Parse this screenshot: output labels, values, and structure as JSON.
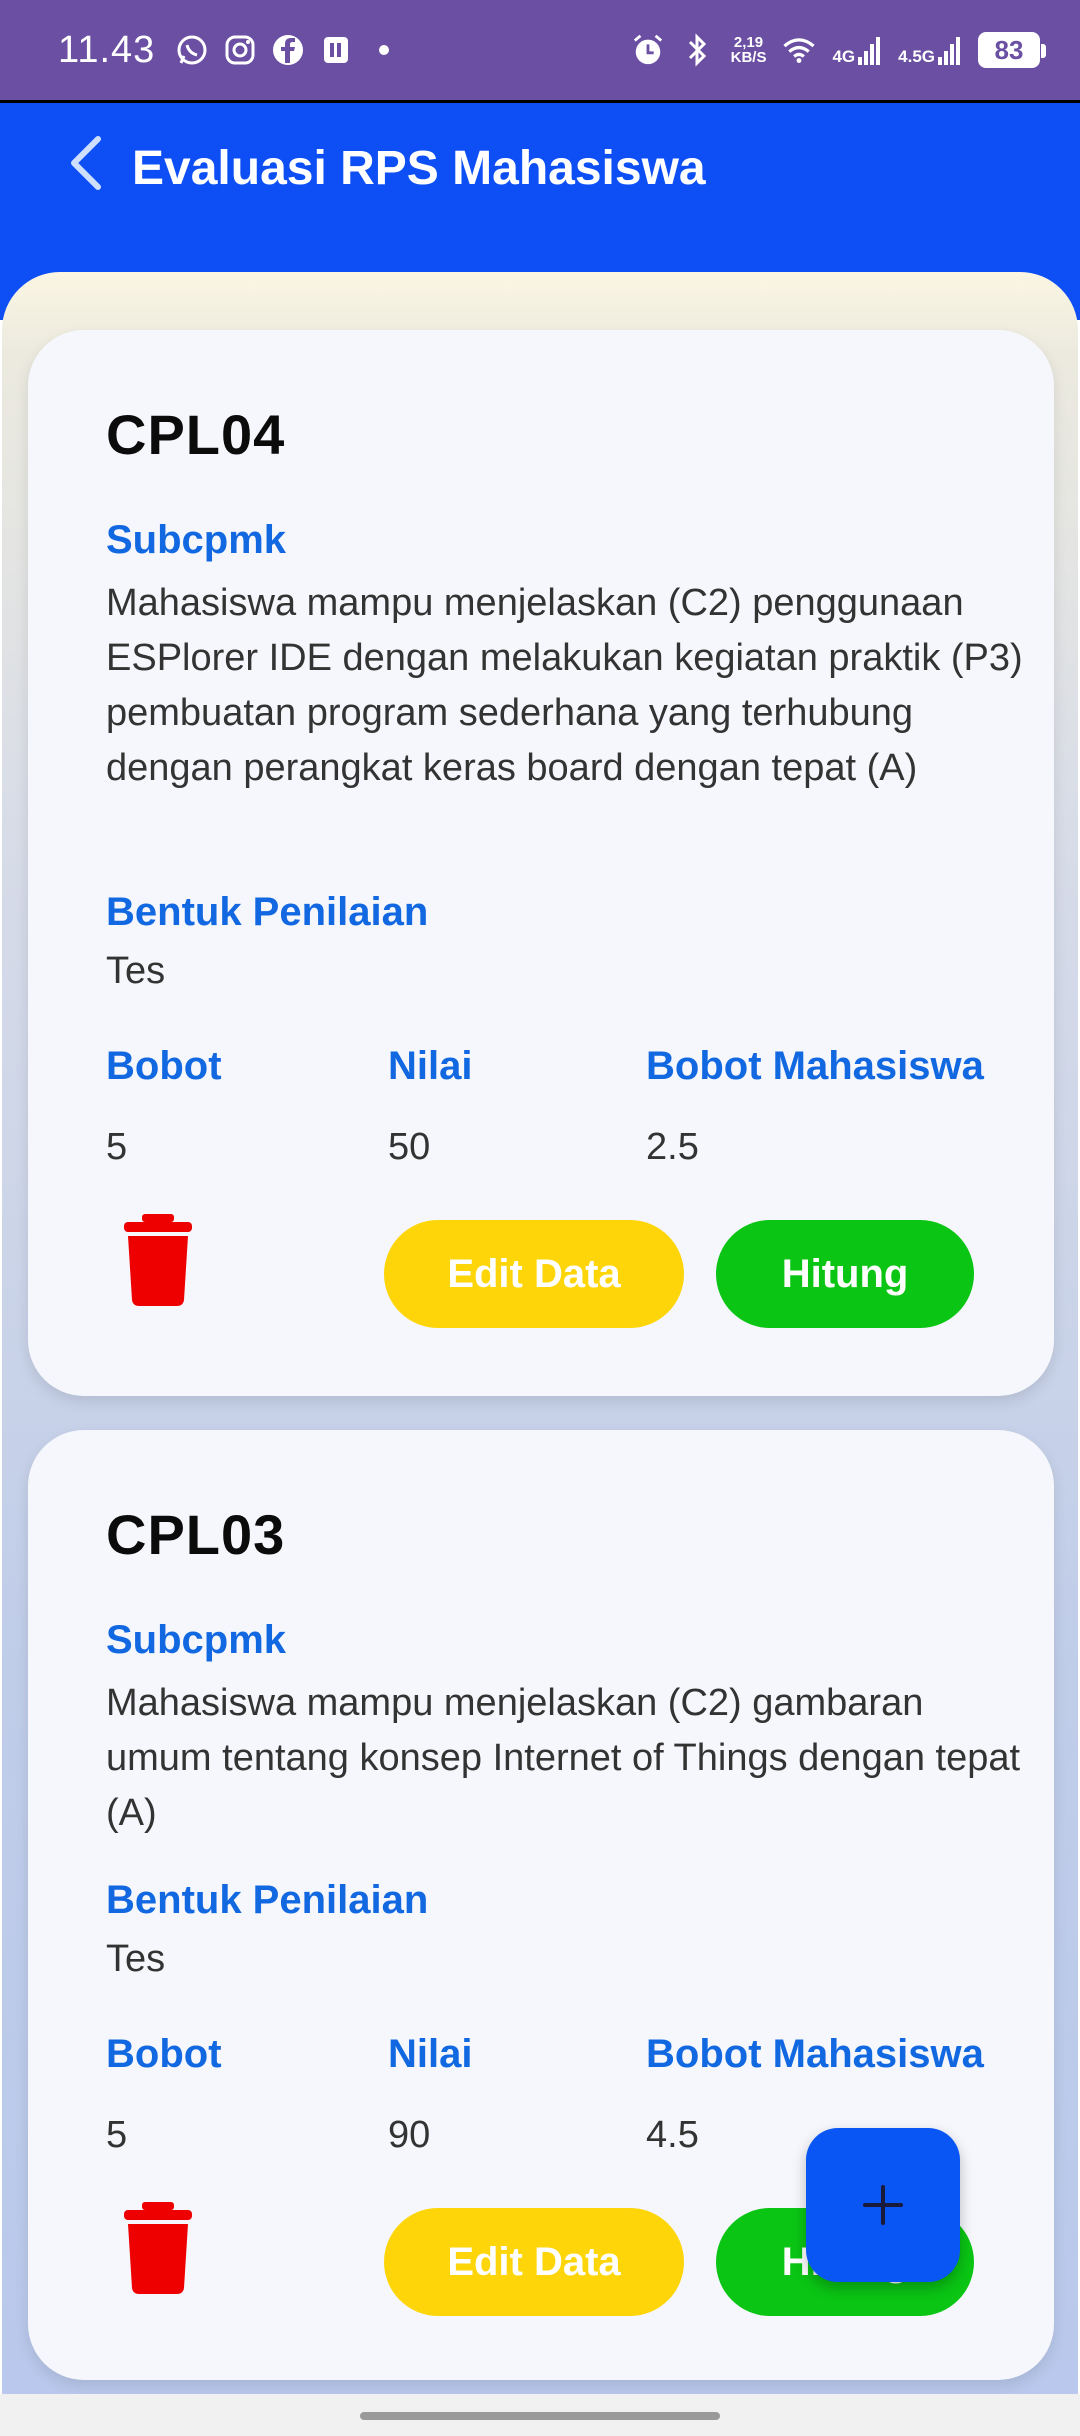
{
  "status_bar": {
    "time": "11.43",
    "speed_top": "2,19",
    "speed_bottom": "KB/S",
    "net1": "4G",
    "net2": "4.5G",
    "battery": "83",
    "icons": [
      "whatsapp-icon",
      "instagram-icon",
      "facebook-icon",
      "nfc-icon",
      "dot-icon",
      "alarm-icon",
      "bluetooth-icon",
      "wifi-icon",
      "signal-icon"
    ]
  },
  "app_bar": {
    "title": "Evaluasi RPS Mahasiswa",
    "back_icon": "chevron-left-icon",
    "background": "#0d4ff5"
  },
  "cards": [
    {
      "title": "CPL04",
      "subcpmk_label": "Subcpmk",
      "subcpmk_text": "Mahasiswa mampu menjelaskan (C2) penggunaan ESPlorer IDE dengan melakukan kegiatan praktik (P3) pembuatan program sederhana yang terhubung dengan perangkat keras board dengan tepat (A)",
      "bentuk_label": "Bentuk Penilaian",
      "bentuk_value": "Tes",
      "bobot_label": "Bobot",
      "bobot_value": "5",
      "nilai_label": "Nilai",
      "nilai_value": "50",
      "bobot_mhs_label": "Bobot Mahasiswa",
      "bobot_mhs_value": "2.5",
      "edit_label": "Edit Data",
      "hitung_label": "Hitung"
    },
    {
      "title": "CPL03",
      "subcpmk_label": "Subcpmk",
      "subcpmk_text": "Mahasiswa mampu  menjelaskan (C2) gambaran umum tentang konsep Internet of Things dengan tepat (A)",
      "bentuk_label": "Bentuk Penilaian",
      "bentuk_value": "Tes",
      "bobot_label": "Bobot",
      "bobot_value": "5",
      "nilai_label": "Nilai",
      "nilai_value": "90",
      "bobot_mhs_label": "Bobot Mahasiswa",
      "bobot_mhs_value": "4.5",
      "edit_label": "Edit Data",
      "hitung_label": "Hitung"
    }
  ],
  "fab": {
    "icon": "plus-icon"
  },
  "colors": {
    "label_blue": "#1268e0",
    "edit_yellow": "#fdd509",
    "hitung_green": "#0ac514",
    "trash_red": "#ee0000",
    "fab_blue": "#0a56f5"
  }
}
